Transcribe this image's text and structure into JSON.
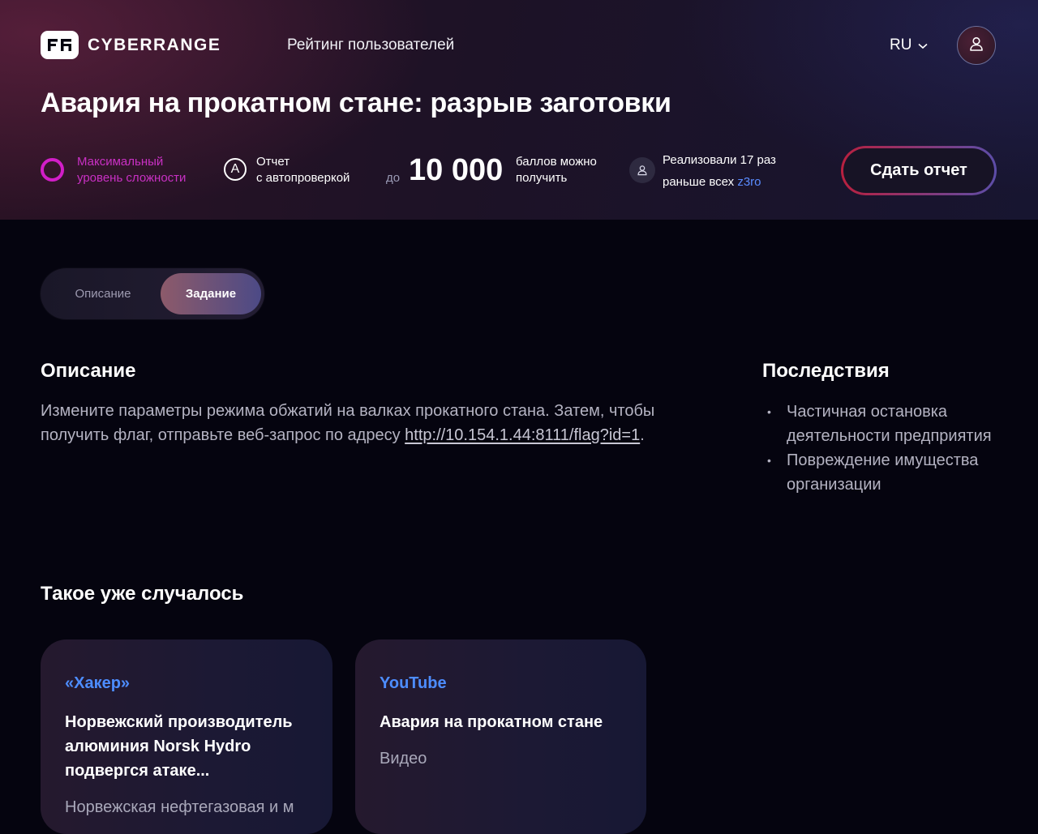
{
  "header": {
    "brand": "CYBERRANGE",
    "nav_link": "Рейтинг пользователей",
    "lang": "RU"
  },
  "task": {
    "title": "Авария на прокатном стане: разрыв заготовки",
    "difficulty": {
      "line1": "Максимальный",
      "line2": "уровень сложности",
      "color": "#d21ec8"
    },
    "autocheck": {
      "icon_letter": "A",
      "line1": "Отчет",
      "line2": "с автопроверкой"
    },
    "points": {
      "prefix": "до",
      "value": "10 000",
      "line1": "баллов можно",
      "line2": "получить"
    },
    "solvers": {
      "line1": "Реализовали 17 раз",
      "line2_prefix": "раньше всех",
      "first_user": "z3ro"
    },
    "submit_label": "Сдать отчет"
  },
  "tabs": [
    {
      "label": "Описание",
      "active": false
    },
    {
      "label": "Задание",
      "active": true
    }
  ],
  "description": {
    "heading": "Описание",
    "text_before": "Измените параметры режима обжатий на валках прокатного стана. Затем, чтобы получить флаг, отправьте веб-запрос по адресу ",
    "link": "http://10.154.1.44:8111/flag?id=1",
    "text_after": "."
  },
  "consequences": {
    "heading": "Последствия",
    "items": [
      "Частичная остановка деятельности предприятия",
      "Повреждение имущества организации"
    ]
  },
  "happened": {
    "heading": "Такое уже случалось",
    "cards": [
      {
        "source": "«Хакер»",
        "title": "Норвежский производитель алюминия Norsk Hydro подвергся атаке...",
        "subtitle": "Норвежская нефтегазовая и м"
      },
      {
        "source": "YouTube",
        "title": "Авария на прокатном стане",
        "subtitle": "Видео"
      }
    ]
  },
  "colors": {
    "accent_link": "#4d8dff",
    "difficulty": "#d21ec8"
  }
}
